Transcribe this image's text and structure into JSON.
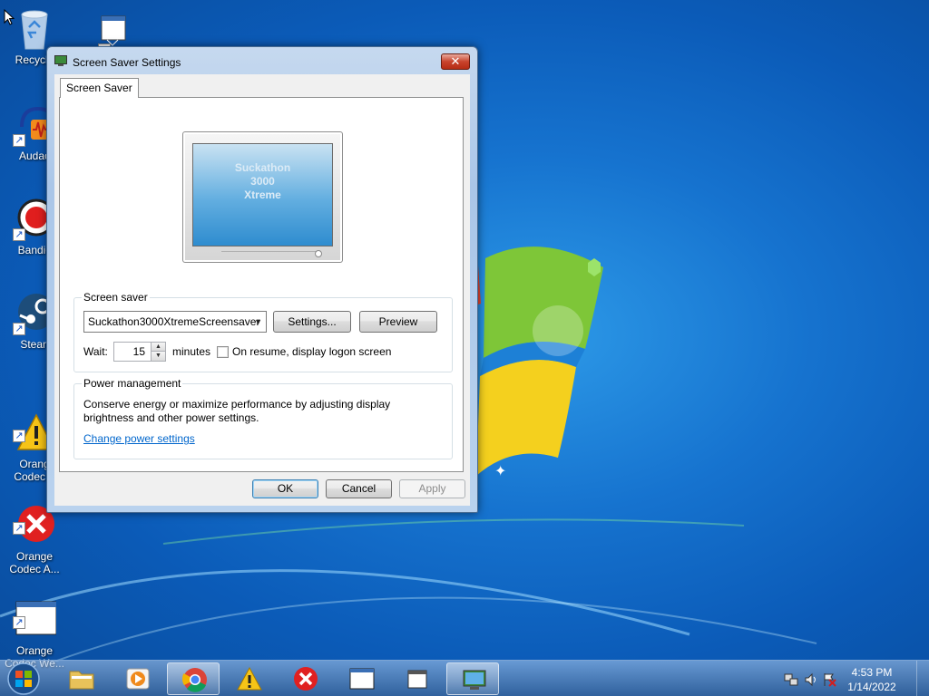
{
  "desktop": {
    "icons": [
      {
        "label": "Recycle",
        "icon": "recycle-bin-icon"
      },
      {
        "label": "",
        "icon": "window-shortcut-icon"
      },
      {
        "label": "Audac",
        "icon": "audacity-icon"
      },
      {
        "label": "Bandic",
        "icon": "bandicam-icon"
      },
      {
        "label": "Stean",
        "icon": "steam-icon"
      },
      {
        "label": "Orang\nCodec A",
        "icon": "warning-icon"
      },
      {
        "label": "Orange\nCodec A...",
        "icon": "error-icon"
      },
      {
        "label": "Orange\nCodec We...",
        "icon": "window-icon"
      }
    ]
  },
  "dialog": {
    "title": "Screen Saver Settings",
    "close_symbol": "✕",
    "tab_label": "Screen Saver",
    "preview_text": "Suckathon\n3000\nXtreme",
    "screensaver_group": {
      "title": "Screen saver",
      "selected": "Suckathon3000XtremeScreensaver",
      "settings_label": "Settings...",
      "preview_label": "Preview",
      "wait_label": "Wait:",
      "wait_value": "15",
      "minutes_label": "minutes",
      "resume_checked": false,
      "resume_label": "On resume, display logon screen"
    },
    "power_group": {
      "title": "Power management",
      "description_line1": "Conserve energy or maximize performance by adjusting display",
      "description_line2": "brightness and other power settings.",
      "link_label": "Change power settings"
    },
    "buttons": {
      "ok": "OK",
      "cancel": "Cancel",
      "apply": "Apply"
    }
  },
  "taskbar": {
    "items": [
      {
        "icon": "file-explorer-icon",
        "active": false
      },
      {
        "icon": "media-player-icon",
        "active": false
      },
      {
        "icon": "chrome-icon",
        "active": true
      },
      {
        "icon": "warning-icon",
        "active": false
      },
      {
        "icon": "error-icon",
        "active": false
      },
      {
        "icon": "window-icon",
        "active": false
      },
      {
        "icon": "window-shortcut-icon",
        "active": false
      },
      {
        "icon": "screen-saver-settings-icon",
        "active": true
      }
    ],
    "clock": {
      "time": "4:53 PM",
      "date": "1/14/2022"
    }
  },
  "colors": {
    "accent": "#0066cc",
    "wallpaper": "#1673cf",
    "close_button": "#c8432c"
  }
}
